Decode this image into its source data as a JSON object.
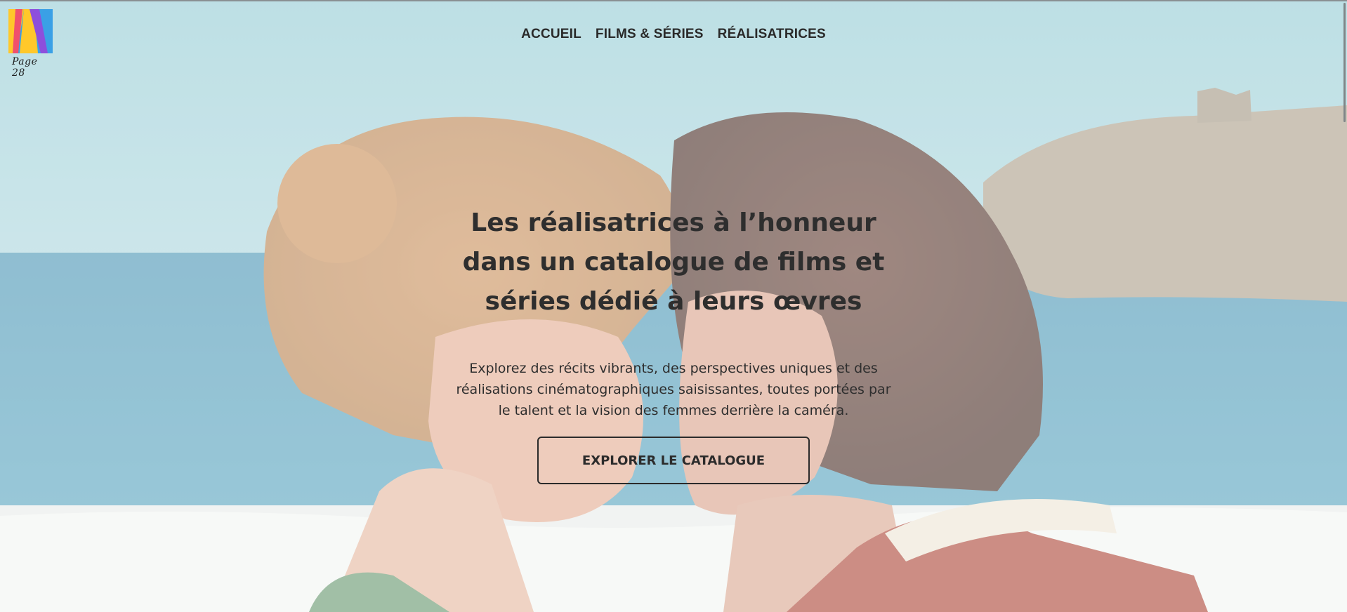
{
  "logo": {
    "text": "Page 28"
  },
  "nav": {
    "items": [
      {
        "label": "ACCUEIL"
      },
      {
        "label": "FILMS & SÉRIES"
      },
      {
        "label": "RÉALISATRICES"
      }
    ]
  },
  "hero": {
    "title": "Les réalisatrices à l’honneur dans un catalogue de films et séries dédié à leurs œvres",
    "description": "Explorez des récits vibrants, des perspectives uniques et des réalisations cinématographiques saisissantes, toutes portées par le talent et la vision des femmes derrière la caméra.",
    "cta_label": "EXPLORER LE CATALOGUE"
  },
  "colors": {
    "text": "#2e2e2e",
    "sky": "#9fcfd6",
    "sea": "#4b9bb7"
  }
}
